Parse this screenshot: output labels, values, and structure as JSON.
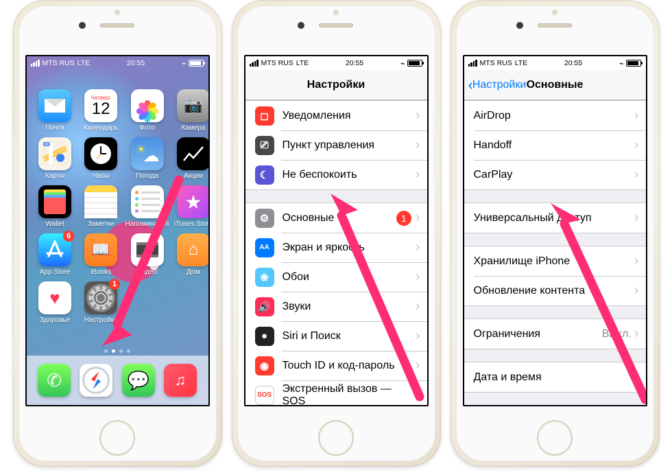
{
  "status": {
    "carrier": "MTS RUS",
    "net": "LTE",
    "time": "20:55"
  },
  "calendar": {
    "dow": "Четверг",
    "day": "12"
  },
  "home": {
    "r1": [
      {
        "name": "ic-mail",
        "label": "Почта"
      },
      {
        "name": "ic-cal",
        "label": "Календарь"
      },
      {
        "name": "ic-photos",
        "label": "Фото"
      },
      {
        "name": "ic-cam",
        "label": "Камера"
      }
    ],
    "r2": [
      {
        "name": "ic-maps",
        "label": "Карты"
      },
      {
        "name": "ic-clock",
        "label": "Часы"
      },
      {
        "name": "ic-weather",
        "label": "Погода"
      },
      {
        "name": "ic-stocks",
        "label": "Акции"
      }
    ],
    "r3": [
      {
        "name": "ic-wallet",
        "label": "Wallet"
      },
      {
        "name": "ic-notes",
        "label": "Заметки"
      },
      {
        "name": "ic-rem",
        "label": "Напоминания"
      },
      {
        "name": "ic-itunes",
        "label": "iTunes Store"
      }
    ],
    "r4": [
      {
        "name": "ic-appstore",
        "label": "App Store",
        "badge": "6"
      },
      {
        "name": "ic-ibooks",
        "label": "iBooks"
      },
      {
        "name": "ic-video",
        "label": "Видео"
      },
      {
        "name": "ic-home",
        "label": "Дом"
      }
    ],
    "r5": [
      {
        "name": "ic-health",
        "label": "Здоровье"
      },
      {
        "name": "ic-settings",
        "label": "Настройки",
        "badge": "1"
      }
    ]
  },
  "settings": {
    "title": "Настройки",
    "g1": [
      {
        "icon": "ri-notif",
        "glyph": "◻︎",
        "label": "Уведомления"
      },
      {
        "icon": "ri-cc",
        "glyph": "⎚",
        "label": "Пункт управления"
      },
      {
        "icon": "ri-dnd",
        "glyph": "☾",
        "label": "Не беспокоить"
      }
    ],
    "g2": [
      {
        "icon": "ri-gen",
        "glyph": "⚙︎",
        "label": "Основные",
        "badge": "1"
      },
      {
        "icon": "ri-disp",
        "glyph": "AA",
        "label": "Экран и яркость"
      },
      {
        "icon": "ri-wall",
        "glyph": "❀",
        "label": "Обои"
      },
      {
        "icon": "ri-sound",
        "glyph": "🔊",
        "label": "Звуки"
      },
      {
        "icon": "ri-siri",
        "glyph": "●",
        "label": "Siri и Поиск"
      },
      {
        "icon": "ri-touch",
        "glyph": "◉",
        "label": "Touch ID и код-пароль"
      },
      {
        "icon": "ri-sos",
        "glyph": "SOS",
        "label": "Экстренный вызов — SOS"
      }
    ]
  },
  "general": {
    "back": "Настройки",
    "title": "Основные",
    "g1": [
      {
        "label": "AirDrop"
      },
      {
        "label": "Handoff"
      },
      {
        "label": "CarPlay"
      }
    ],
    "g2": [
      {
        "label": "Универсальный доступ"
      }
    ],
    "g3": [
      {
        "label": "Хранилище iPhone"
      },
      {
        "label": "Обновление контента"
      }
    ],
    "g4": [
      {
        "label": "Ограничения",
        "value": "Выкл."
      }
    ],
    "g5": [
      {
        "label": "Дата и время"
      }
    ]
  }
}
